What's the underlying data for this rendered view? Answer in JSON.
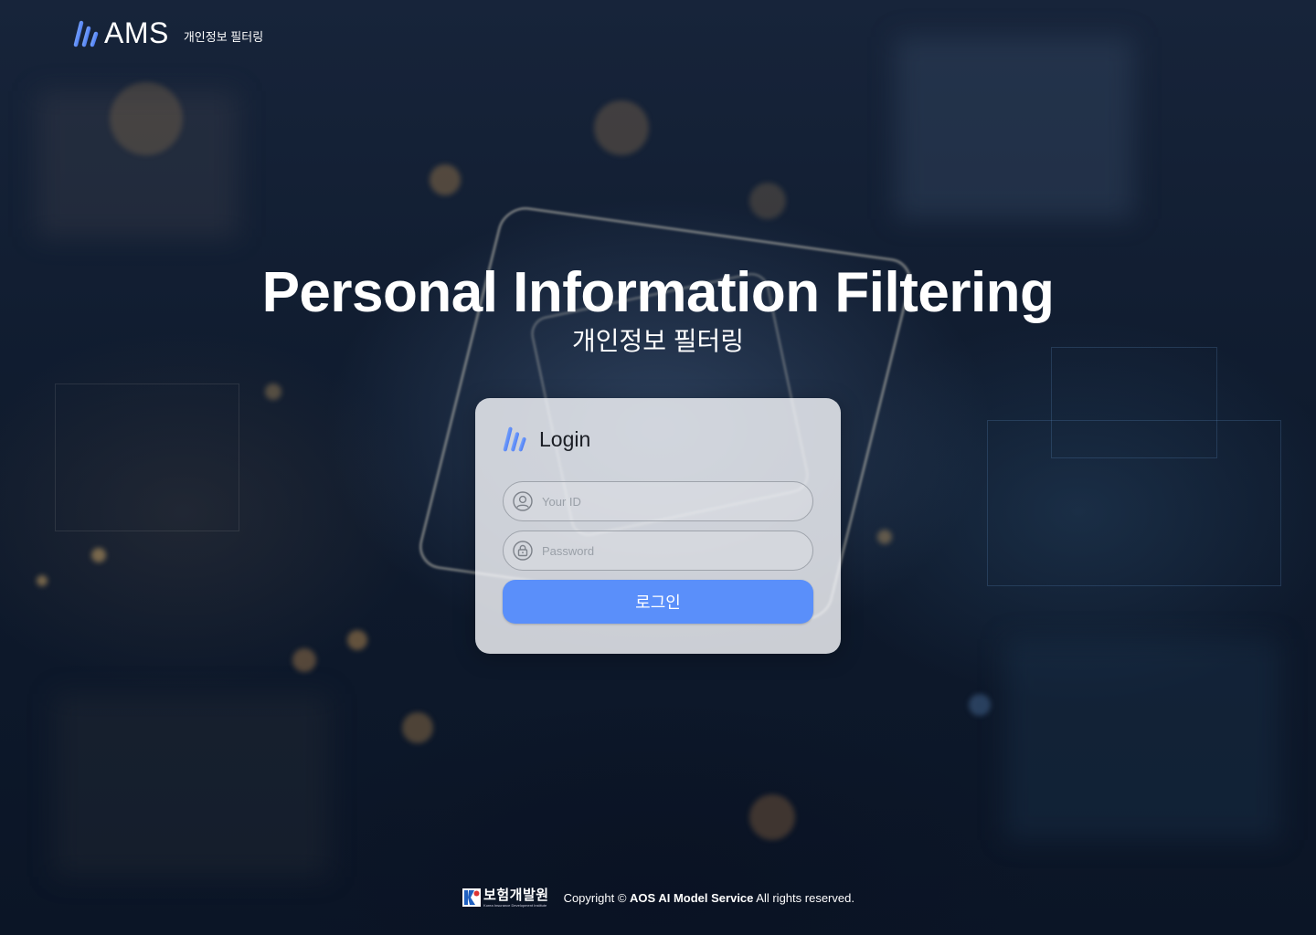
{
  "header": {
    "brand": "AMS",
    "subtitle": "개인정보 필터링"
  },
  "hero": {
    "title": "Personal Information Filtering",
    "subtitle": "개인정보 필터링"
  },
  "login": {
    "title": "Login",
    "id_placeholder": "Your ID",
    "password_placeholder": "Password",
    "submit_label": "로그인"
  },
  "footer": {
    "org_name": "보험개발원",
    "org_name_en": "Korea Insurance Development Institute",
    "copyright_prefix": "Copyright",
    "copyright_symbol": "©",
    "company": "AOS AI Model Service",
    "rights": "All rights reserved."
  },
  "colors": {
    "accent": "#5a8ffa",
    "logo_gradient_start": "#8ab4ff",
    "logo_gradient_end": "#3b6cf0",
    "background": "#0c1526"
  },
  "icons": {
    "logo": "ams-logo-icon",
    "user": "user-icon",
    "lock": "lock-icon"
  }
}
